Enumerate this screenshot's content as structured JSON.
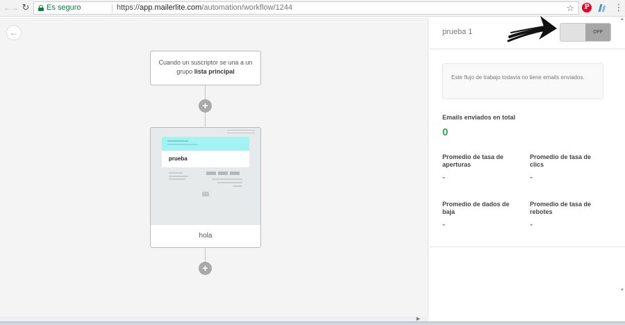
{
  "browser": {
    "secure_label": "Es seguro",
    "url_scheme": "https://",
    "url_host": "app.mailerlite.com",
    "url_path": "/automation/workflow/1244",
    "back_icon": "arrow-left-icon",
    "forward_icon": "arrow-right-icon",
    "reload_icon": "reload-icon",
    "bookmark_icon": "star-icon",
    "extension_icons": [
      "pinterest-icon",
      "extension-icon"
    ],
    "menu_icon": "kebab-menu-icon"
  },
  "canvas": {
    "back_icon": "arrow-left-icon",
    "trigger": {
      "text": "Cuando un suscriptor se una a un grupo",
      "group_name": "lista principal"
    },
    "add_step_label": "+",
    "email_card": {
      "preview_title": "prueba",
      "label": "hola"
    }
  },
  "panel": {
    "workflow_name": "prueba 1",
    "toggle": {
      "state_label": "OFF",
      "is_on": false
    },
    "info_message": "Este flujo de trabajo todavía no tiene emails enviados.",
    "stats": {
      "emails_sent_label": "Emails enviados en total",
      "emails_sent_value": "0",
      "open_rate_label": "Promedio de tasa de aperturas",
      "open_rate_value": "-",
      "click_rate_label": "Promedio de tasa de clics",
      "click_rate_value": "-",
      "unsub_rate_label": "Promedio de dados de baja",
      "unsub_rate_value": "-",
      "bounce_rate_label": "Promedio de tasa de rebotes",
      "bounce_rate_value": "-"
    }
  },
  "colors": {
    "secure_green": "#0b8043",
    "stat_green": "#2fa45a",
    "stat_blue": "#3d8dc9",
    "stat_red": "#e05a4d",
    "preview_header": "#a4f3f3"
  }
}
